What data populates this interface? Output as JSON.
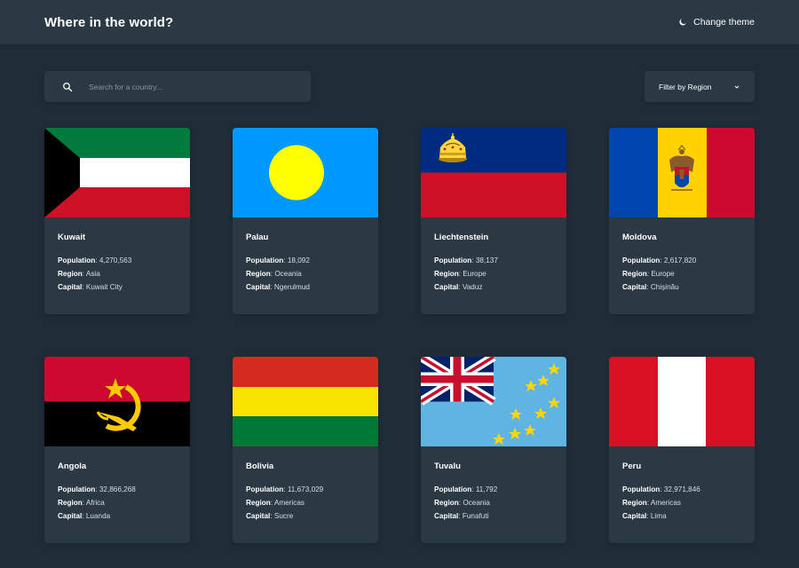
{
  "header": {
    "title": "Where in the world?",
    "theme_label": "Change theme"
  },
  "search": {
    "placeholder": "Search for a country..."
  },
  "filter": {
    "label": "Filter by Region"
  },
  "labels": {
    "population": "Population",
    "region": "Region",
    "capital": "Capital"
  },
  "icons": {
    "theme": "moon-icon",
    "search": "search-icon",
    "filter": "chevron-down-icon"
  },
  "colors": {
    "background": "#202c37",
    "surface": "#2b3945",
    "text": "#ffffff"
  },
  "countries": [
    {
      "name": "Kuwait",
      "population": "4,270,563",
      "region": "Asia",
      "capital": "Kuwait City",
      "flag": "kuwait"
    },
    {
      "name": "Palau",
      "population": "18,092",
      "region": "Oceania",
      "capital": "Ngerulmud",
      "flag": "palau"
    },
    {
      "name": "Liechtenstein",
      "population": "38,137",
      "region": "Europe",
      "capital": "Vaduz",
      "flag": "liechtenstein"
    },
    {
      "name": "Moldova",
      "population": "2,617,820",
      "region": "Europe",
      "capital": "Chișinău",
      "flag": "moldova"
    },
    {
      "name": "Angola",
      "population": "32,866,268",
      "region": "Africa",
      "capital": "Luanda",
      "flag": "angola"
    },
    {
      "name": "Bolivia",
      "population": "11,673,029",
      "region": "Americas",
      "capital": "Sucre",
      "flag": "bolivia"
    },
    {
      "name": "Tuvalu",
      "population": "11,792",
      "region": "Oceania",
      "capital": "Funafuti",
      "flag": "tuvalu"
    },
    {
      "name": "Peru",
      "population": "32,971,846",
      "region": "Americas",
      "capital": "Lima",
      "flag": "peru"
    }
  ]
}
